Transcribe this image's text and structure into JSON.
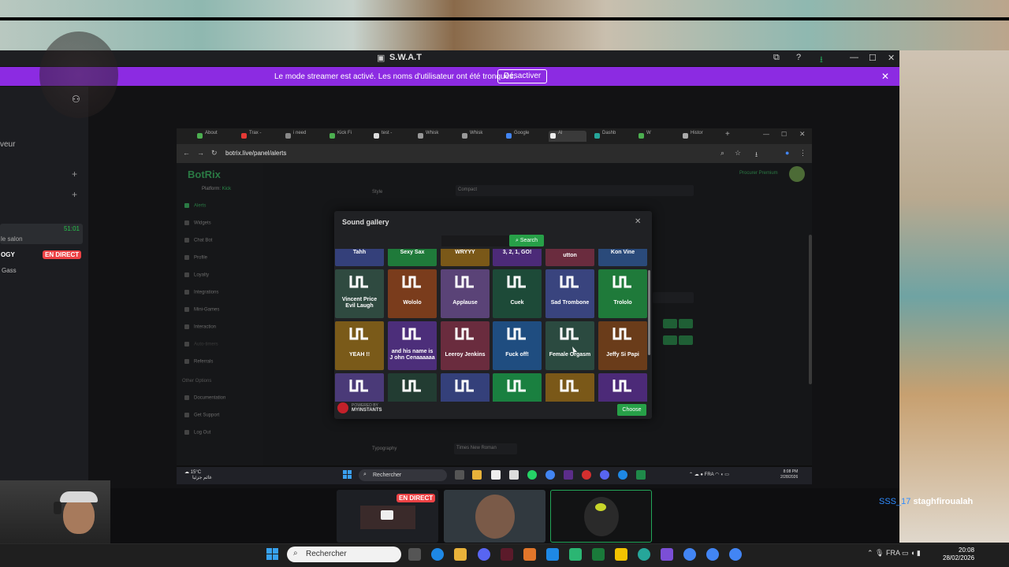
{
  "discord": {
    "title": "S.W.A.T",
    "banner_text": "Le mode streamer est activé. Les noms d'utilisateur ont été tronqués.",
    "banner_button": "Désactiver",
    "sidebar_label": "veur",
    "channel_time": "51:01",
    "channel_label": "le salon",
    "live_user": "OGY",
    "live_badge": "EN DIRECT",
    "voice_user": "Gass"
  },
  "browser": {
    "tabs": [
      "About",
      "Trax -",
      "i need",
      "Kick Fi",
      "test -",
      "Whisk",
      "Whisk",
      "Google",
      "Al",
      "Dashb",
      "W",
      "Histor"
    ],
    "url": "botrix.live/panel/alerts"
  },
  "botrix": {
    "brand": "BotRix",
    "platform_label": "Platform:",
    "platform_value": "Kick",
    "nav": [
      "Alerts",
      "Widgets",
      "Chat Bot",
      "Profile",
      "Loyalty",
      "Integrations",
      "Mini-Games",
      "Interaction",
      "Auto-timers",
      "Referrals"
    ],
    "other_options": "Other Options",
    "nav2": [
      "Documentation",
      "Get Support",
      "Log Out"
    ],
    "style_label": "Style",
    "style_value": "Compact",
    "typography_label": "Typography",
    "typography_value": "Times New Roman",
    "premium": "Procurer Premium"
  },
  "modal": {
    "title": "Sound gallery",
    "search_button": "Search",
    "partial_row": [
      "Tahh",
      "Sexy Sax",
      "WRYYY",
      "3, 2, 1, GO!",
      "utton",
      "Kon Vine"
    ],
    "rows": [
      [
        {
          "name": "Vincent Price Evil Laugh",
          "color": "#2f4a40"
        },
        {
          "name": "Wololo",
          "color": "#7a3c1c"
        },
        {
          "name": "Applause",
          "color": "#5a4377"
        },
        {
          "name": "Cuek",
          "color": "#1d4a38"
        },
        {
          "name": "Sad Trombone",
          "color": "#39447e"
        },
        {
          "name": "Trololo",
          "color": "#1f7a3a"
        }
      ],
      [
        {
          "name": "YEAH !!",
          "color": "#7a5a19"
        },
        {
          "name": "and his name is J ohn Cenaaaaaa",
          "color": "#4c2e7a"
        },
        {
          "name": "Leeroy Jenkins",
          "color": "#6a2c3e"
        },
        {
          "name": "Fuck off!",
          "color": "#1f4d80"
        },
        {
          "name": "Female Orgasm",
          "color": "#2b4a40"
        },
        {
          "name": "Jeffy Si Papi",
          "color": "#6a3c1a"
        }
      ],
      [
        {
          "name": "",
          "color": "#4a3a78"
        },
        {
          "name": "",
          "color": "#223c32"
        },
        {
          "name": "",
          "color": "#34407a"
        },
        {
          "name": "",
          "color": "#1a8040"
        },
        {
          "name": "",
          "color": "#7a5818"
        },
        {
          "name": "",
          "color": "#4c2a78"
        }
      ]
    ],
    "powered_by": "POWERED BY",
    "powered_brand": "MYINSTANTS",
    "choose_button": "Choose"
  },
  "inner_taskbar": {
    "temp": "15°C",
    "weather_sub": "غائم جزئيا",
    "search": "Rechercher",
    "lang": "FRA",
    "time": "8:08 PM",
    "date": "2/28/2026"
  },
  "stream": {
    "live_badge": "EN DIRECT",
    "overlay_user": "SSS_17",
    "overlay_name": "staghfiroualah"
  },
  "host_taskbar": {
    "search": "Rechercher",
    "lang": "FRA",
    "time": "20:08",
    "date": "28/02/2026"
  },
  "colors": {
    "accent_purple": "#8c2be2",
    "green": "#27a048",
    "live_red": "#ed4245"
  }
}
